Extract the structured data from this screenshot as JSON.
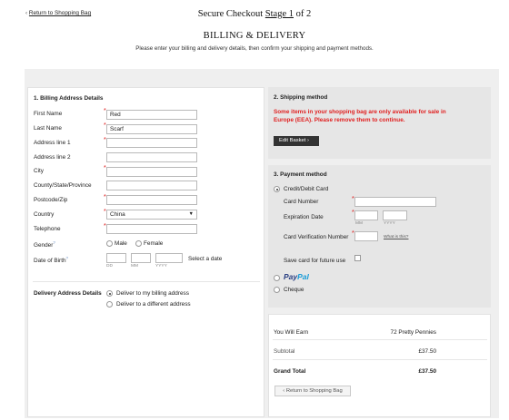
{
  "header": {
    "back_link": "Return to Shopping Bag",
    "checkout_prefix": "Secure Checkout ",
    "stage_label": "Stage 1",
    "checkout_suffix": " of 2",
    "section_title": "BILLING & DELIVERY",
    "instructions": "Please enter your billing and delivery details, then confirm your shipping and payment methods."
  },
  "billing": {
    "title": "1. Billing Address Details",
    "first_name_label": "First Name",
    "first_name_value": "Red",
    "last_name_label": "Last Name",
    "last_name_value": "Scarf",
    "address1_label": "Address line 1",
    "address2_label": "Address line 2",
    "city_label": "City",
    "county_label": "County/State/Province",
    "postcode_label": "Postcode/Zip",
    "country_label": "Country",
    "country_value": "China",
    "telephone_label": "Telephone",
    "gender_label": "Gender",
    "gender_male": "Male",
    "gender_female": "Female",
    "dob_label": "Date of Birth",
    "dob_hint_dd": "DD",
    "dob_hint_mm": "MM",
    "dob_hint_yyyy": "YYYY",
    "select_date": "Select a date"
  },
  "delivery": {
    "label": "Delivery Address Details",
    "option_billing": "Deliver to my billing address",
    "option_different": "Deliver to a different address"
  },
  "shipping": {
    "title": "2. Shipping method",
    "warning": "Some items in your shopping bag are only available for sale in Europe (EEA). Please remove them to continue.",
    "edit_button": "Edit Basket"
  },
  "payment": {
    "title": "3. Payment method",
    "credit_option": "Credit/Debit Card",
    "card_number_label": "Card Number",
    "expiry_label": "Expiration Date",
    "expiry_mm": "MM",
    "expiry_yyyy": "YYYY",
    "cvn_label": "Card Verification Number",
    "what_is_this": "What is this?",
    "save_card_label": "Save card for future use",
    "paypal_pay": "Pay",
    "paypal_pal": "Pal",
    "cheque_option": "Cheque"
  },
  "summary": {
    "earn_label": "You Will Earn",
    "earn_value": "72 Pretty Pennies",
    "subtotal_label": "Subtotal",
    "subtotal_value": "£37.50",
    "grand_total_label": "Grand Total",
    "grand_total_value": "£37.50",
    "return_button": "Return to Shopping Bag"
  },
  "colors": {
    "warning_red": "#e02020",
    "panel_grey": "#efefef",
    "paypal_dark": "#253b80",
    "paypal_light": "#179bd7"
  }
}
